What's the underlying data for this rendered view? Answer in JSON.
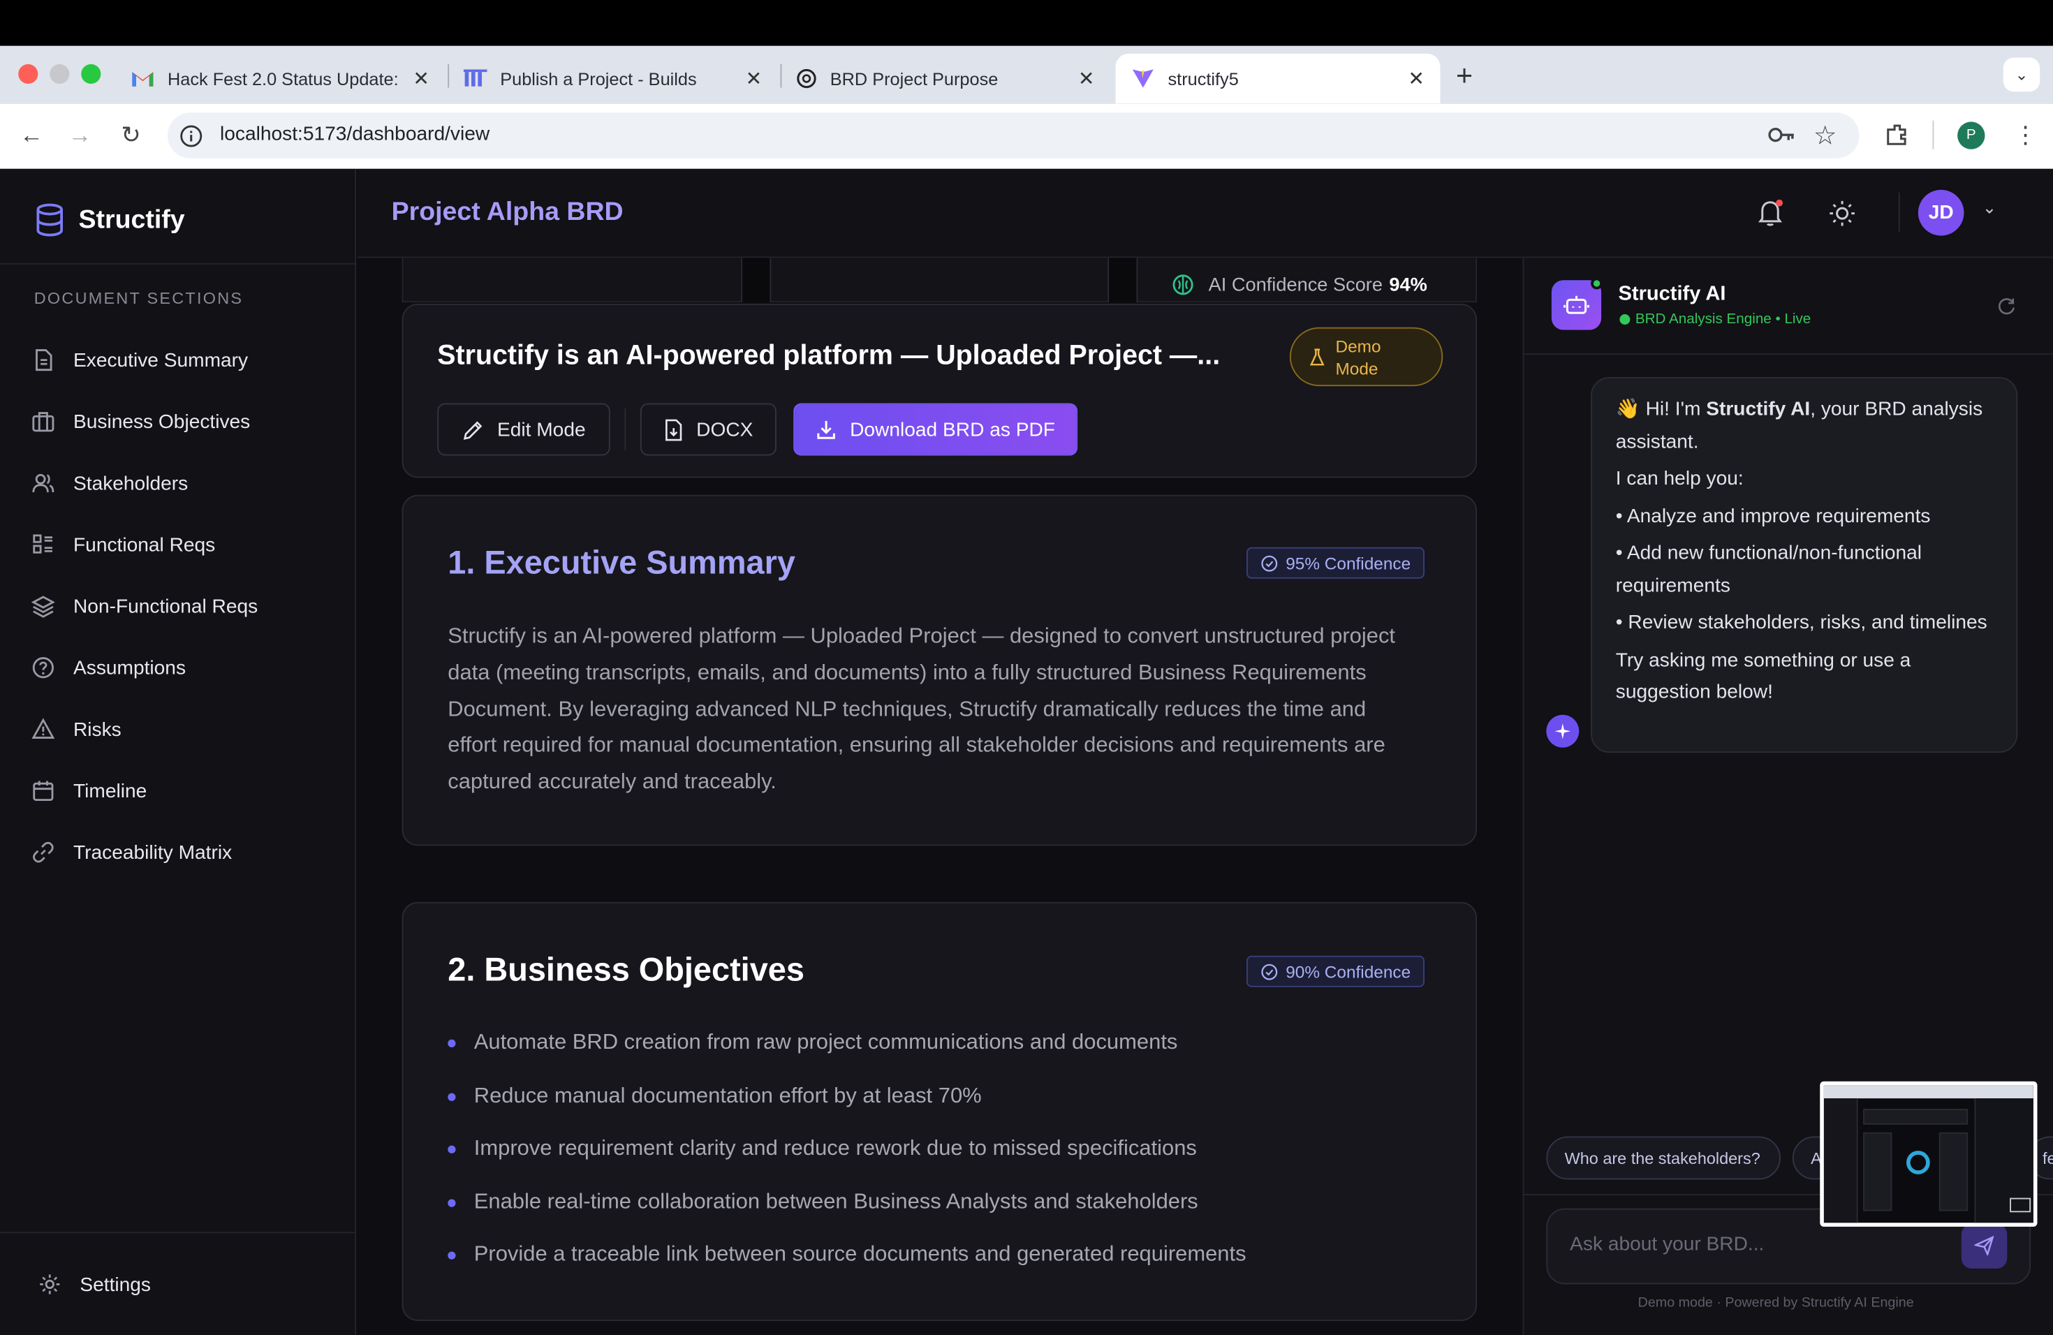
{
  "browser": {
    "tabs": [
      {
        "title": "Hack Fest 2.0 Status Update:"
      },
      {
        "title": "Publish a Project - Builds"
      },
      {
        "title": "BRD Project Purpose"
      },
      {
        "title": "structify5"
      }
    ],
    "url": "localhost:5173/dashboard/view",
    "profile_initial": "P"
  },
  "sidebar": {
    "brand": "Structify",
    "section_heading": "DOCUMENT SECTIONS",
    "items": [
      {
        "label": "Executive Summary",
        "icon": "document-icon"
      },
      {
        "label": "Business Objectives",
        "icon": "briefcase-icon"
      },
      {
        "label": "Stakeholders",
        "icon": "users-icon"
      },
      {
        "label": "Functional Reqs",
        "icon": "list-icon"
      },
      {
        "label": "Non-Functional Reqs",
        "icon": "layers-icon"
      },
      {
        "label": "Assumptions",
        "icon": "help-circle-icon"
      },
      {
        "label": "Risks",
        "icon": "warning-icon"
      },
      {
        "label": "Timeline",
        "icon": "calendar-icon"
      },
      {
        "label": "Traceability Matrix",
        "icon": "link-icon"
      }
    ],
    "settings_label": "Settings"
  },
  "header": {
    "title": "Project Alpha BRD",
    "avatar_initials": "JD"
  },
  "doc_header": {
    "confidence_label": "AI Confidence Score",
    "confidence_value": "94%",
    "title": "Structify is an AI-powered platform — Uploaded Project —...",
    "demo_badge": [
      "Demo",
      "Mode"
    ],
    "edit_label": "Edit Mode",
    "docx_label": "DOCX",
    "download_label": "Download BRD as PDF"
  },
  "sections": {
    "executive": {
      "title": "1. Executive Summary",
      "confidence": "95% Confidence",
      "text": "Structify is an AI-powered platform — Uploaded Project — designed to convert unstructured project data (meeting transcripts, emails, and documents) into a fully structured Business Requirements Document. By leveraging advanced NLP techniques, Structify dramatically reduces the time and effort required for manual documentation, ensuring all stakeholder decisions and requirements are captured accurately and traceably."
    },
    "objectives": {
      "title": "2. Business Objectives",
      "confidence": "90% Confidence",
      "items": [
        "Automate BRD creation from raw project communications and documents",
        "Reduce manual documentation effort by at least 70%",
        "Improve requirement clarity and reduce rework due to missed specifications",
        "Enable real-time collaboration between Business Analysts and stakeholders",
        "Provide a traceable link between source documents and generated requirements"
      ]
    }
  },
  "chat": {
    "name": "Structify AI",
    "status": "BRD Analysis Engine • Live",
    "greeting_pre": "👋 Hi! I'm ",
    "greeting_bold": "Structify AI",
    "greeting_post": ", your BRD analysis assistant.",
    "help_intro": "I can help you:",
    "help_items": [
      "• Analyze and improve requirements",
      "• Add new functional/non-functional requirements",
      "• Review stakeholders, risks, and timelines"
    ],
    "closing": "Try asking me something or use a suggestion below!",
    "suggestions": [
      "Who are the stakeholders?",
      "A",
      "fe"
    ],
    "input_placeholder": "Ask about your BRD...",
    "footer": "Demo mode · Powered by Structify AI Engine"
  },
  "colors": {
    "accent": "#7c4ff0",
    "title_purple": "#a79bf7",
    "live_green": "#34c759",
    "demo_amber": "#e9b64a"
  }
}
